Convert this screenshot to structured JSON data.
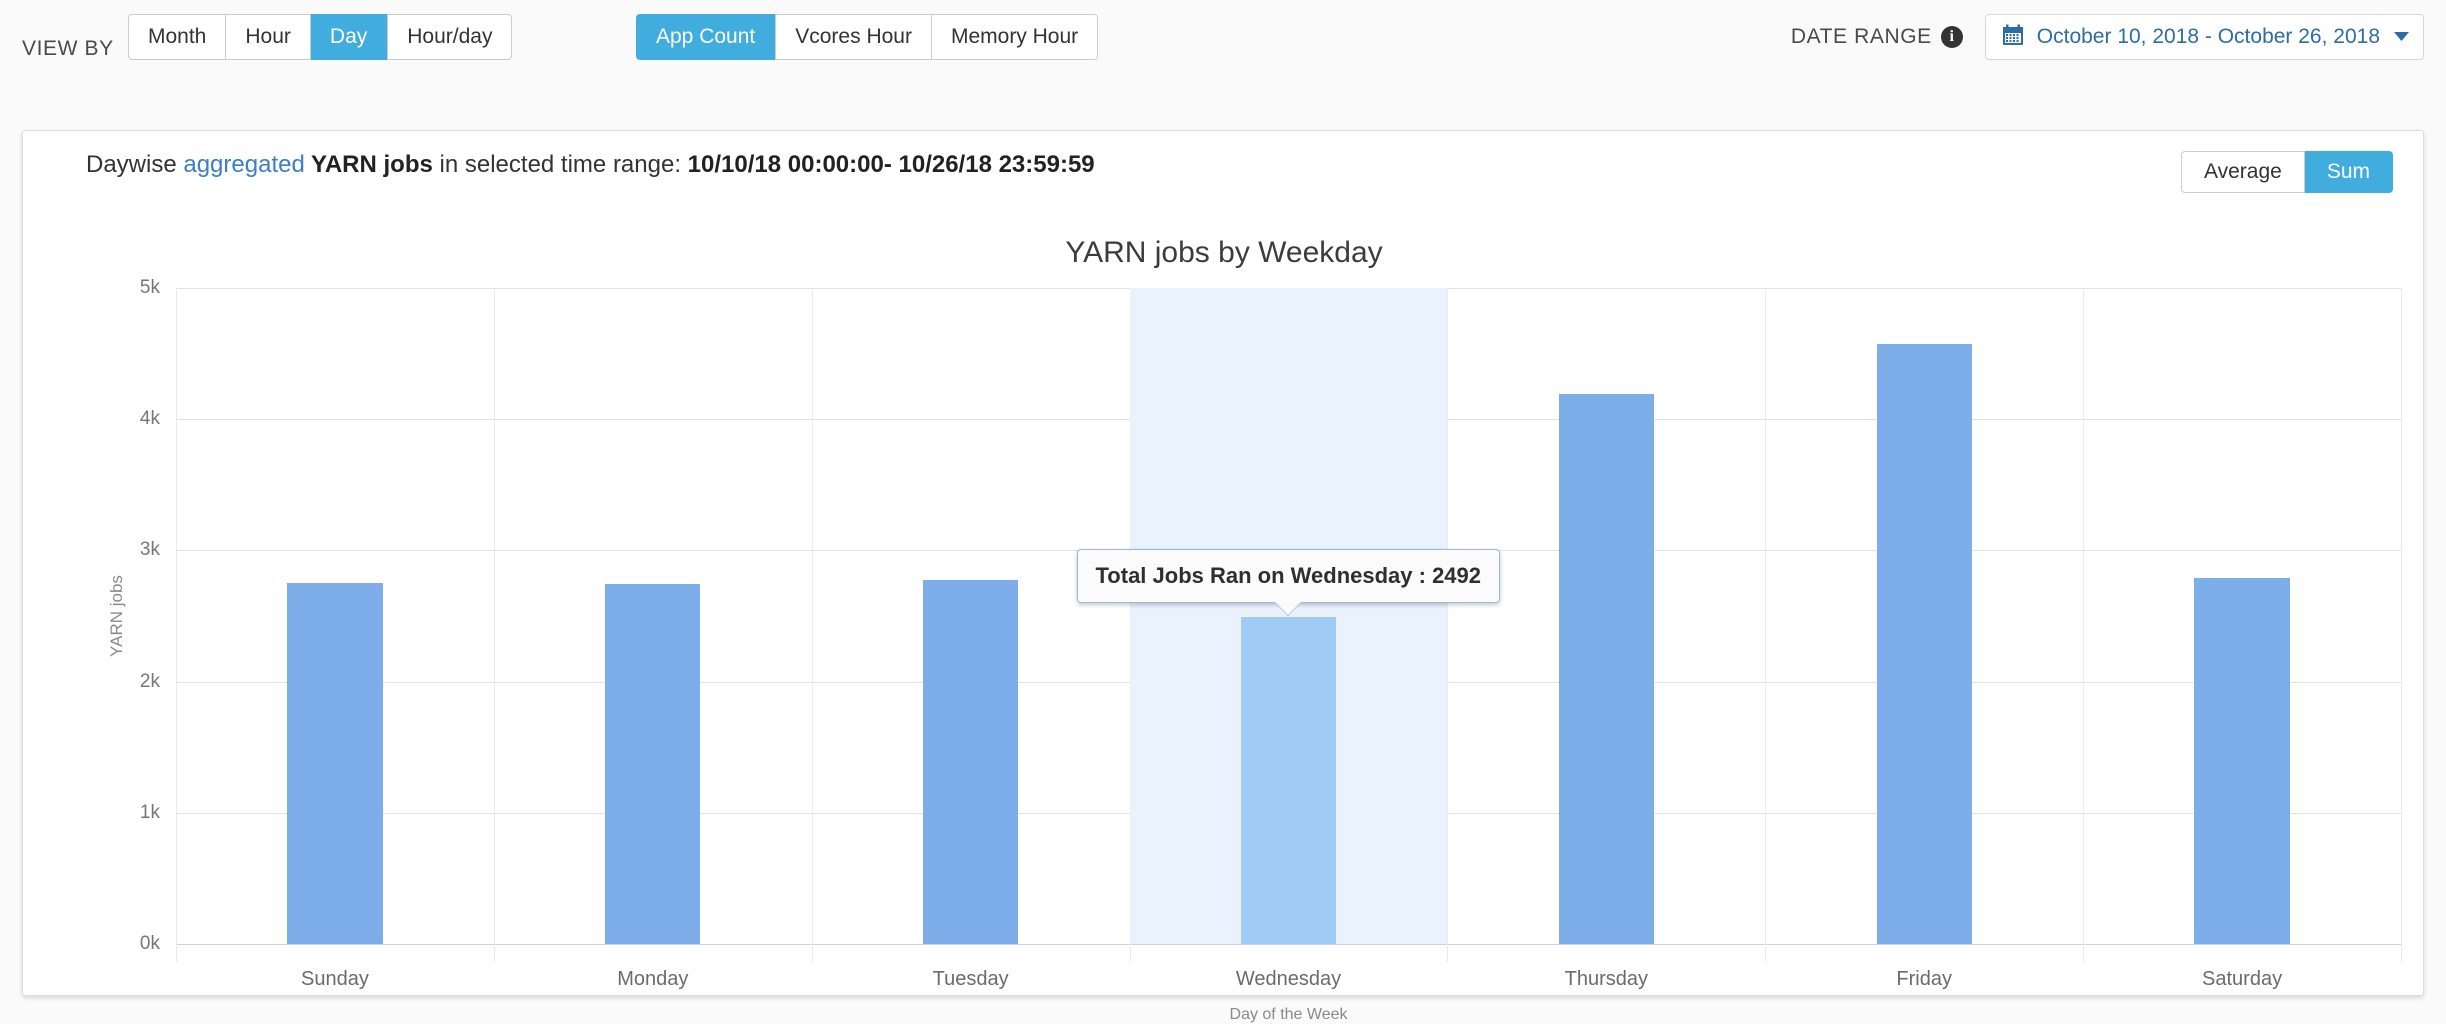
{
  "toolbar": {
    "view_by_label": "VIEW BY",
    "view_by_options": [
      {
        "label": "Month",
        "active": false
      },
      {
        "label": "Hour",
        "active": false
      },
      {
        "label": "Day",
        "active": true
      },
      {
        "label": "Hour/day",
        "active": false
      }
    ],
    "metric_options": [
      {
        "label": "App Count",
        "active": true
      },
      {
        "label": "Vcores Hour",
        "active": false
      },
      {
        "label": "Memory Hour",
        "active": false
      }
    ],
    "date_range_label": "DATE RANGE",
    "info_icon": "info-icon",
    "calendar_icon": "calendar-icon",
    "date_range_value": "October 10, 2018 - October 26, 2018",
    "caret_icon": "chevron-down-icon"
  },
  "card": {
    "title_prefix": "Daywise ",
    "title_link": "aggregated",
    "title_subject": " YARN jobs",
    "title_middle": " in selected time range: ",
    "title_range": "10/10/18 00:00:00- 10/26/18 23:59:59",
    "aggregation_options": [
      {
        "label": "Average",
        "active": false
      },
      {
        "label": "Sum",
        "active": true
      }
    ]
  },
  "tooltip": {
    "text": "Total Jobs Ran on Wednesday : 2492",
    "category": "Wednesday",
    "value": 2492
  },
  "colors": {
    "accent": "#41addf",
    "bar": "#7eaeea",
    "bar_hover": "#9fcbf5",
    "highlight_band": "#eaf2fd",
    "link": "#3b7fc4",
    "date_text": "#2e6da4"
  },
  "chart_data": {
    "type": "bar",
    "title": "YARN jobs by Weekday",
    "xlabel": "Day of the Week",
    "ylabel": "YARN jobs",
    "categories": [
      "Sunday",
      "Monday",
      "Tuesday",
      "Wednesday",
      "Thursday",
      "Friday",
      "Saturday"
    ],
    "values": [
      2750,
      2745,
      2775,
      2492,
      4192,
      4573,
      2790
    ],
    "ylim": [
      0,
      5000
    ],
    "yticks": [
      0,
      1000,
      2000,
      3000,
      4000,
      5000
    ],
    "ytick_labels": [
      "0k",
      "1k",
      "2k",
      "3k",
      "4k",
      "5k"
    ],
    "grid": true,
    "legend": false,
    "highlighted_category": "Wednesday"
  }
}
